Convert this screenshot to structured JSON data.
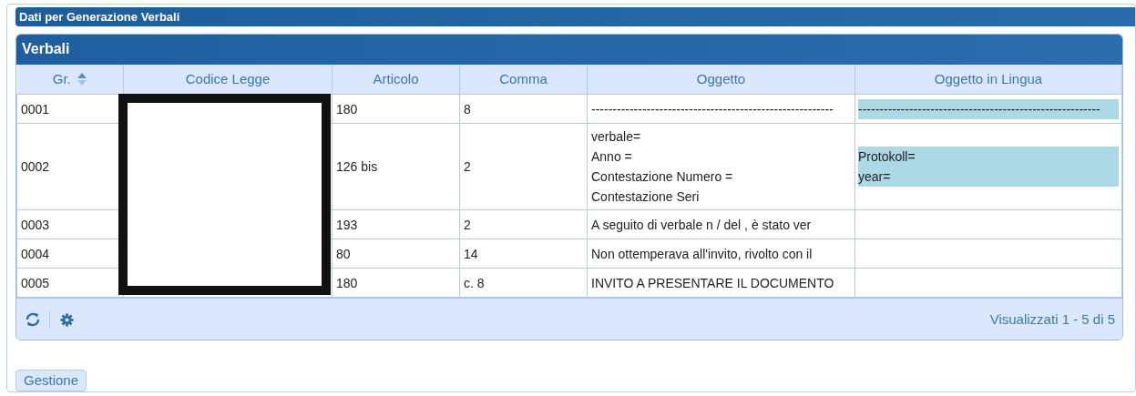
{
  "panel": {
    "title": "Dati per Generazione Verbali"
  },
  "grid": {
    "title": "Verbali",
    "codice_legge_redacted": true,
    "columns": [
      {
        "label": "Gr.",
        "sorted": true
      },
      {
        "label": "Codice Legge",
        "sorted": false
      },
      {
        "label": "Articolo",
        "sorted": false
      },
      {
        "label": "Comma",
        "sorted": false
      },
      {
        "label": "Oggetto",
        "sorted": false
      },
      {
        "label": "Oggetto in Lingua",
        "sorted": false
      }
    ],
    "rows": [
      {
        "gr": "0001",
        "articolo": "180",
        "comma": "8",
        "oggetto": [
          "---------------------------------------------------------"
        ],
        "oggetto_in_lingua": [
          "---------------------------------------------------------"
        ]
      },
      {
        "gr": "0002",
        "articolo": "126 bis",
        "comma": "2",
        "oggetto": [
          "verbale=",
          "Anno =",
          "Contestazione Numero =",
          "Contestazione Seri"
        ],
        "oggetto_in_lingua": [
          "Protokoll=",
          "year="
        ]
      },
      {
        "gr": "0003",
        "articolo": "193",
        "comma": "2",
        "oggetto": [
          "A seguito di verbale n  /  del , è stato ver"
        ],
        "oggetto_in_lingua": []
      },
      {
        "gr": "0004",
        "articolo": "80",
        "comma": "14",
        "oggetto": [
          "Non ottemperava all'invito, rivolto con il"
        ],
        "oggetto_in_lingua": []
      },
      {
        "gr": "0005",
        "articolo": "180",
        "comma": "c. 8",
        "oggetto": [
          "INVITO A PRESENTARE IL DOCUMENTO"
        ],
        "oggetto_in_lingua": []
      }
    ],
    "pager": "Visualizzati 1 - 5 di 5"
  },
  "buttons": [
    "Gestione"
  ]
}
